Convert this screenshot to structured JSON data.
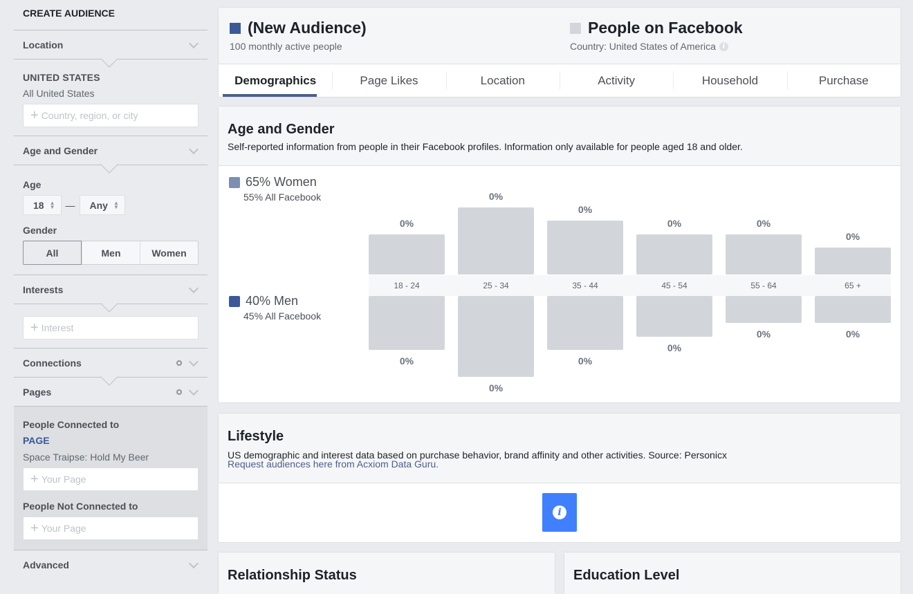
{
  "sidebar": {
    "title": "CREATE AUDIENCE",
    "location": {
      "label": "Location",
      "country": "UNITED STATES",
      "scope": "All United States",
      "placeholder": "Country, region, or city"
    },
    "age_gender": {
      "label": "Age and Gender",
      "age_label": "Age",
      "age_min": "18",
      "age_max": "Any",
      "separator": "—",
      "gender_label": "Gender",
      "gender_options": [
        "All",
        "Men",
        "Women"
      ],
      "gender_selected": "All"
    },
    "interests": {
      "label": "Interests",
      "placeholder": "Interest"
    },
    "connections": {
      "label": "Connections"
    },
    "pages": {
      "label": "Pages",
      "connected_label": "People Connected to",
      "page_caption": "PAGE",
      "page_name": "Space Traipse: Hold My Beer",
      "connected_placeholder": "Your Page",
      "not_connected_label": "People Not Connected to",
      "not_connected_placeholder": "Your Page"
    },
    "advanced": {
      "label": "Advanced"
    }
  },
  "audience": {
    "title": "(New Audience)",
    "subtitle": "100 monthly active people",
    "swatch_color": "#3b5998",
    "compare_title": "People on Facebook",
    "compare_subtitle": "Country: United States of America",
    "compare_swatch_color": "#d2d6db",
    "info_glyph": "i"
  },
  "tabs": [
    {
      "label": "Demographics",
      "active": true
    },
    {
      "label": "Page Likes",
      "active": false
    },
    {
      "label": "Location",
      "active": false
    },
    {
      "label": "Activity",
      "active": false
    },
    {
      "label": "Household",
      "active": false
    },
    {
      "label": "Purchase",
      "active": false
    }
  ],
  "age_gender_section": {
    "title": "Age and Gender",
    "description": "Self-reported information from people in their Facebook profiles. Information only available for people aged 18 and older.",
    "women": {
      "label": "65% Women",
      "sub": "55% All Facebook",
      "color": "#7b8fb5"
    },
    "men": {
      "label": "40% Men",
      "sub": "45% All Facebook",
      "color": "#3b5998"
    }
  },
  "chart_data": {
    "type": "bar",
    "title": "Age and Gender",
    "categories": [
      "18 - 24",
      "25 - 34",
      "35 - 44",
      "45 - 54",
      "55 - 64",
      "65 +"
    ],
    "series": [
      {
        "name": "Women (All Facebook comparison)",
        "direction": "up",
        "values": [
          15,
          25,
          20,
          15,
          15,
          10
        ],
        "labels": [
          "0%",
          "0%",
          "0%",
          "0%",
          "0%",
          "0%"
        ],
        "color": "#d2d6db"
      },
      {
        "name": "Men (All Facebook comparison)",
        "direction": "down",
        "values": [
          20,
          30,
          20,
          15,
          10,
          10
        ],
        "labels": [
          "0%",
          "0%",
          "0%",
          "0%",
          "0%",
          "0%"
        ],
        "color": "#d2d6db"
      }
    ],
    "xlabel": "",
    "ylabel": "",
    "grid": false,
    "legend": "left"
  },
  "lifestyle": {
    "title": "Lifestyle",
    "description": "US demographic and interest data based on purchase behavior, brand affinity and other activities. Source: Personicx",
    "link": "Request audiences here from Acxiom Data Guru.",
    "info_glyph": "i"
  },
  "relationship": {
    "title": "Relationship Status"
  },
  "education": {
    "title": "Education Level"
  }
}
